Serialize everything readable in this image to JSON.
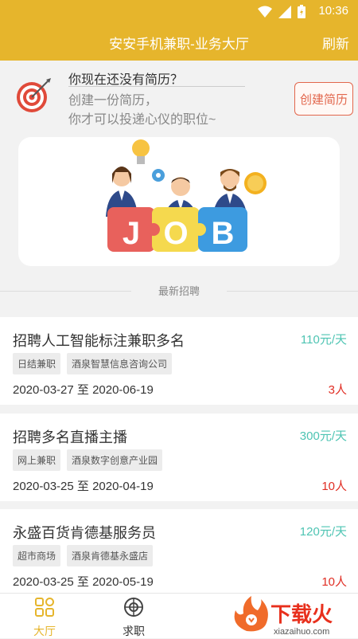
{
  "status_bar": {
    "time": "10:36",
    "icons": [
      "wifi-icon",
      "signal-icon",
      "battery-icon"
    ]
  },
  "app_bar": {
    "title": "安安手机兼职-业务大厅",
    "refresh_label": "刷新"
  },
  "resume_prompt": {
    "line1": "你现在还没有简历？",
    "line2": "创建一份简历，",
    "line3": "你才可以投递心仪的职位~",
    "create_button": "创建简历"
  },
  "banner": {
    "letters": [
      "J",
      "O",
      "B"
    ]
  },
  "section_title": "最新招聘",
  "jobs": [
    {
      "title": "招聘人工智能标注兼职多名",
      "salary": "110元/天",
      "tags": [
        "日结兼职",
        "酒泉智慧信息咨询公司"
      ],
      "dates": "2020-03-27 至 2020-06-19",
      "count": "3人"
    },
    {
      "title": "招聘多名直播主播",
      "salary": "300元/天",
      "tags": [
        "网上兼职",
        "酒泉数字创意产业园"
      ],
      "dates": "2020-03-25 至 2020-04-19",
      "count": "10人"
    },
    {
      "title": "永盛百货肯德基服务员",
      "salary": "120元/天",
      "tags": [
        "超市商场",
        "酒泉肯德基永盛店"
      ],
      "dates": "2020-03-25 至 2020-05-19",
      "count": "10人"
    }
  ],
  "bottom_nav": [
    {
      "label": "大厅",
      "icon": "grid-icon",
      "active": true
    },
    {
      "label": "求职",
      "icon": "crosshair-icon",
      "active": false
    }
  ],
  "watermark": {
    "text": "下载火",
    "url_text": "xiazaihuo.com"
  },
  "colors": {
    "accent": "#e6b52c",
    "salary": "#4ec4b3",
    "count": "#e02e24",
    "button": "#e2664c"
  }
}
